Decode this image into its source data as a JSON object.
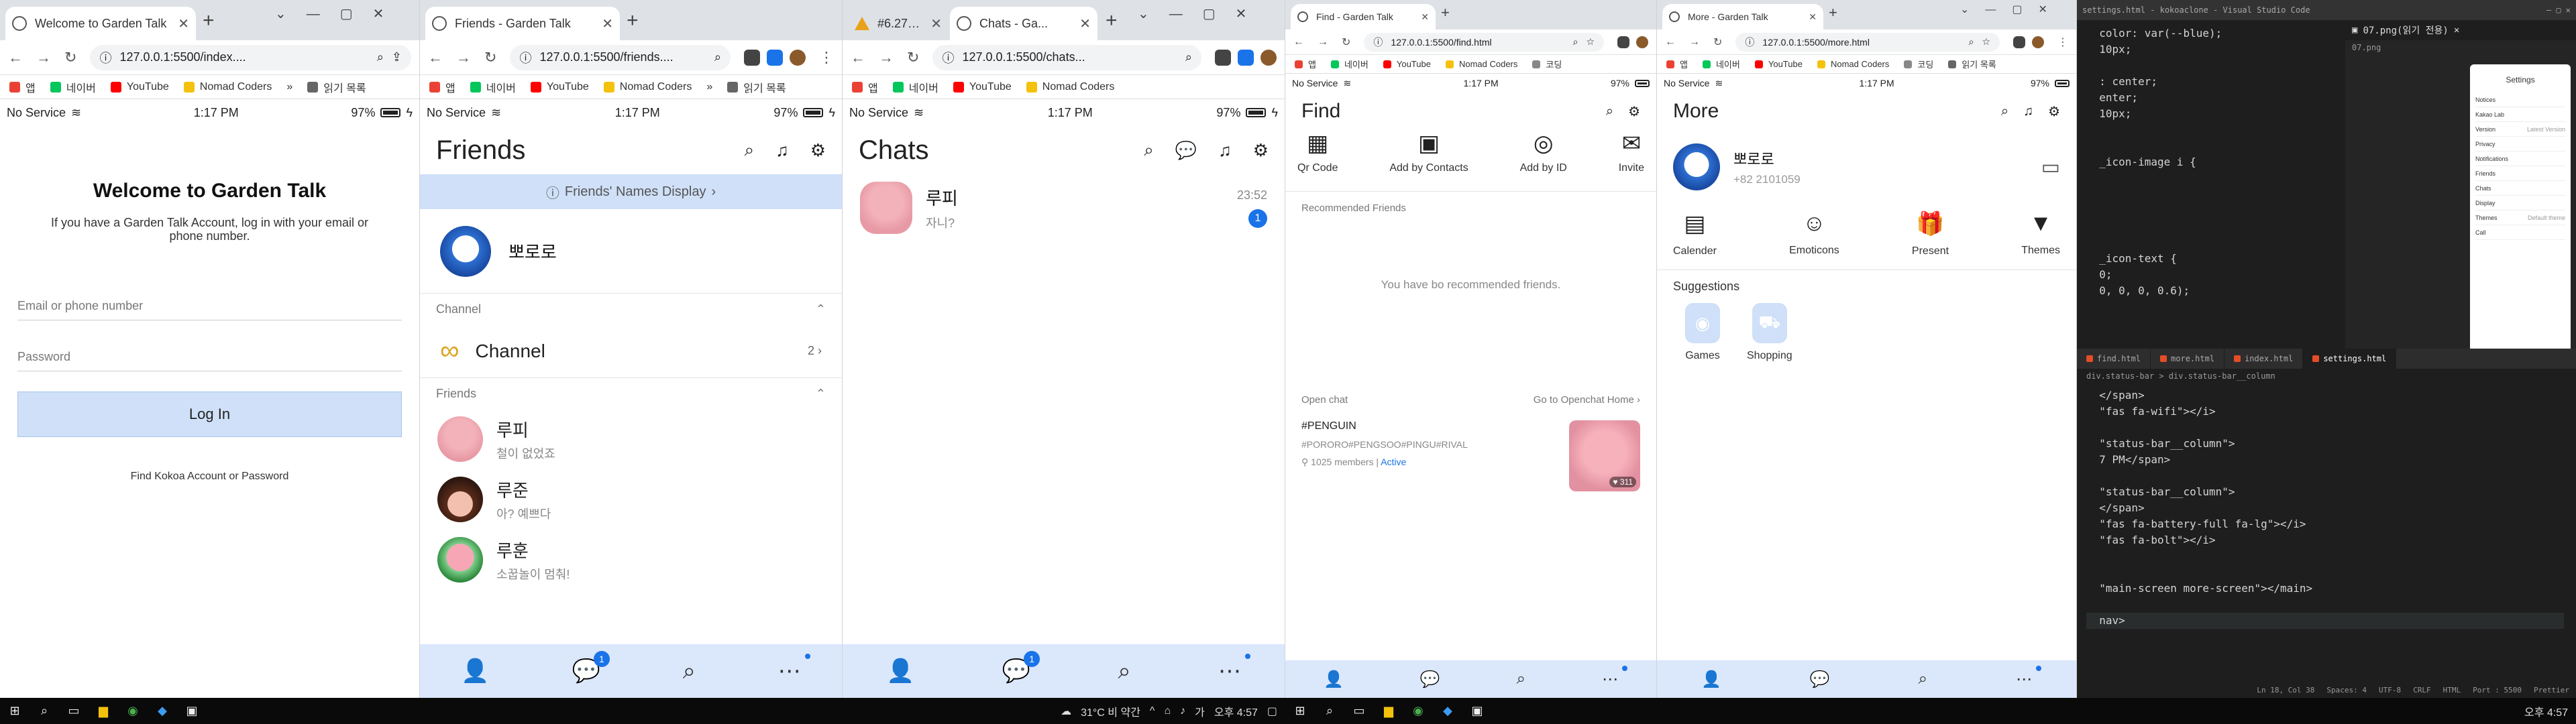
{
  "phone_status": {
    "carrier": "No Service",
    "time": "1:17 PM",
    "battery": "97%"
  },
  "bookmarks": [
    "앱",
    "네이버",
    "YouTube",
    "Nomad Coders",
    "»",
    "읽기 목록"
  ],
  "bookmarks_short": [
    "앱",
    "네이버",
    "YouTube",
    "Nomad Coders",
    "코딩",
    "읽기 목록"
  ],
  "windows": {
    "w1": {
      "tab_title": "Welcome to Garden Talk",
      "url": "127.0.0.1:5500/index....",
      "welcome": {
        "title": "Welcome to Garden Talk",
        "text": "If you have a Garden Talk Account, log in with your email or phone number.",
        "email_placeholder": "Email or phone number",
        "password_placeholder": "Password",
        "login_button": "Log In",
        "find_link": "Find Kokoa Account or Password"
      }
    },
    "w2": {
      "tab_title": "Friends - Garden Talk",
      "url": "127.0.0.1:5500/friends....",
      "friends": {
        "title": "Friends",
        "banner": "Friends' Names Display",
        "profile_name": "뽀로로",
        "channel_section": "Channel",
        "channel_label": "Channel",
        "channel_count": "2",
        "friends_section": "Friends",
        "list": [
          {
            "name": "루피",
            "status": "철이 없었죠"
          },
          {
            "name": "루준",
            "status": "아? 예쁘다"
          },
          {
            "name": "루훈",
            "status": "소꿉놀이 멈춰!"
          }
        ]
      },
      "nav_badge": "1"
    },
    "w3": {
      "tab1_title": "#6.27 Setti...",
      "tab2_title": "Chats - Ga...",
      "url": "127.0.0.1:5500/chats...",
      "chats": {
        "title": "Chats",
        "list": [
          {
            "name": "루피",
            "message": "자니?",
            "time": "23:52",
            "unread": "1"
          }
        ]
      },
      "nav_badge": "1"
    },
    "w4": {
      "tab_title": "Find - Garden Talk",
      "url": "127.0.0.1:5500/find.html",
      "find": {
        "title": "Find",
        "actions": [
          {
            "label": "Qr Code",
            "icon": "qr-code-icon"
          },
          {
            "label": "Add by Contacts",
            "icon": "contacts-icon"
          },
          {
            "label": "Add by ID",
            "icon": "fingerprint-icon"
          },
          {
            "label": "Invite",
            "icon": "mail-icon"
          }
        ],
        "recommended_head": "Recommended Friends",
        "empty": "You have bo recommended friends.",
        "open_chat_head": "Open chat",
        "open_chat_link": "Go to Openchat Home",
        "open_chat": {
          "title": "#PENGUIN",
          "tags": "#PORORO#PENGSOO#PINGU#RIVAL",
          "members": "1025 members",
          "active": "Active",
          "likes": "311"
        }
      }
    },
    "w5": {
      "tab_title": "More - Garden Talk",
      "url": "127.0.0.1:5500/more.html",
      "more": {
        "title": "More",
        "name": "뽀로로",
        "phone": "+82 2101059",
        "grid": [
          "Calender",
          "Emoticons",
          "Present",
          "Themes"
        ],
        "suggestions_title": "Suggestions",
        "suggestions": [
          "Games",
          "Shopping"
        ]
      }
    }
  },
  "vscode": {
    "title": "settings.html - kokoaclone - Visual Studio Code",
    "code_top": [
      "  color: var(--blue);",
      "  10px;",
      "",
      "  : center;",
      "  enter;",
      "  10px;",
      "",
      "",
      "  _icon-image i {",
      "",
      "",
      "",
      "",
      "",
      "  _icon-text {",
      "  0;",
      "  0, 0, 0, 0.6);"
    ],
    "preview_tab": "07.png(읽기 전용)",
    "preview_file": "07.png",
    "phone_title": "Settings",
    "phone_items": [
      {
        "label": "Notices",
        "value": ""
      },
      {
        "label": "Kakao Lab",
        "value": ""
      },
      {
        "label": "Version",
        "value": "Latest Version"
      },
      {
        "label": "Privacy",
        "value": ""
      },
      {
        "label": "Notifications",
        "value": ""
      },
      {
        "label": "Friends",
        "value": ""
      },
      {
        "label": "Chats",
        "value": ""
      },
      {
        "label": "Display",
        "value": ""
      },
      {
        "label": "Themes",
        "value": "Default theme"
      },
      {
        "label": "Call",
        "value": ""
      }
    ],
    "tabs": [
      "find.html",
      "more.html",
      "index.html",
      "settings.html"
    ],
    "breadcrumb": "div.status-bar > div.status-bar__column",
    "code_bottom": [
      "  </span>",
      "  \"fas fa-wifi\"></i>",
      "",
      "  \"status-bar__column\">",
      "  7 PM</span>",
      "",
      "  \"status-bar__column\">",
      "  </span>",
      "  \"fas fa-battery-full fa-lg\"></i>",
      "  \"fas fa-bolt\"></i>",
      "",
      "",
      "  \"main-screen more-screen\"></main>",
      "",
      "  nav>"
    ],
    "status": [
      "Ln 18, Col 38",
      "Spaces: 4",
      "UTF-8",
      "CRLF",
      "HTML",
      "Port : 5500",
      "Prettier"
    ]
  },
  "taskbar": {
    "weather": "31°C 비 약간",
    "time": "오후 4:57",
    "time2": "오후 4:57"
  }
}
